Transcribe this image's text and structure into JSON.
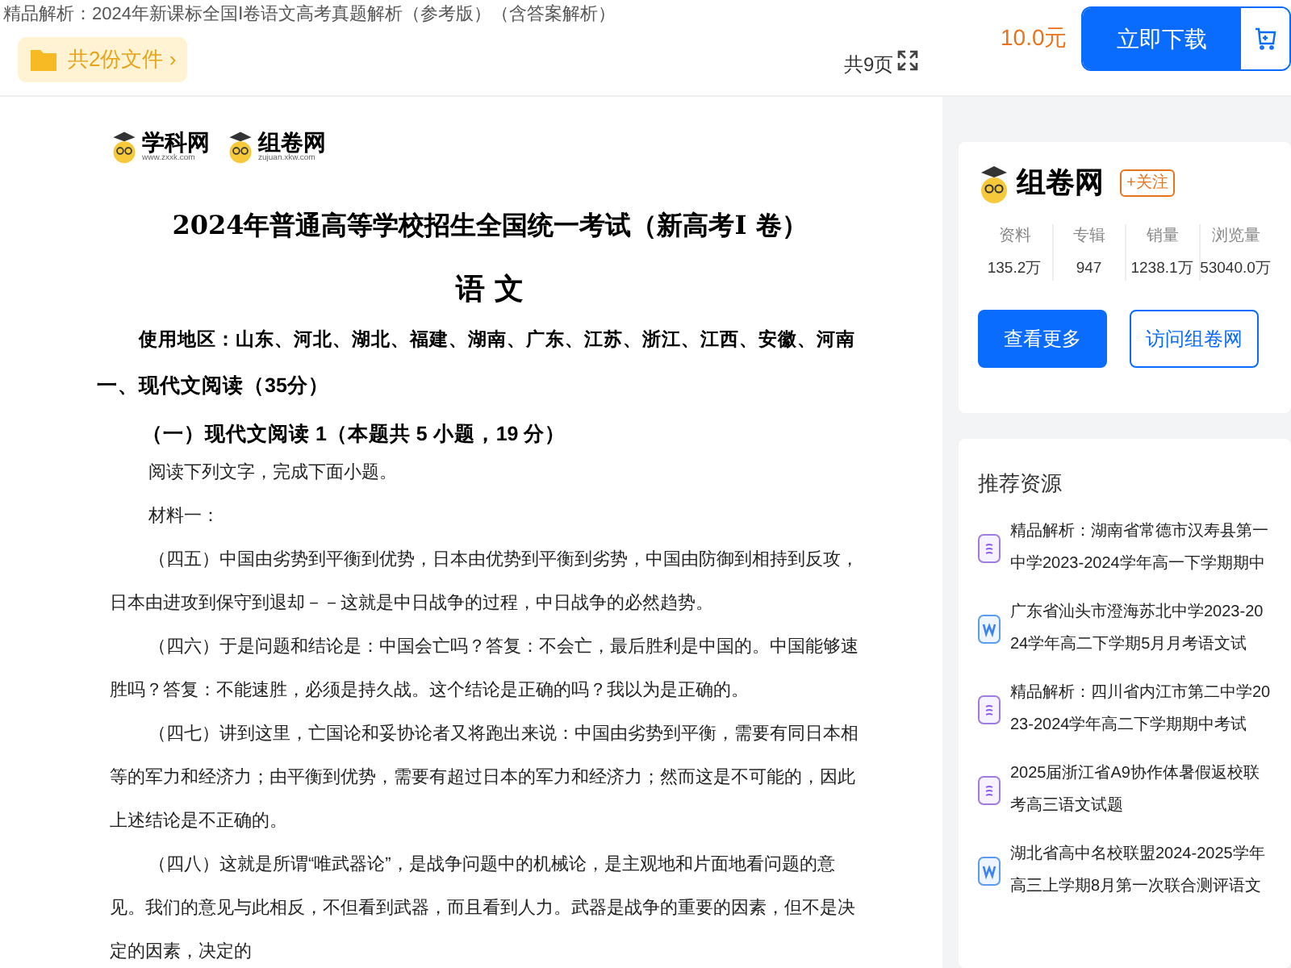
{
  "header": {
    "title": "精品解析：2024年新课标全国Ⅰ卷语文高考真题解析（参考版）（含答案解析）",
    "files_button": "共2份文件 ›",
    "page_count": "共9页",
    "price": "10.0元",
    "download_button": "立即下载"
  },
  "document": {
    "logos": [
      {
        "name": "学科网",
        "url": "www.zxxk.com"
      },
      {
        "name": "组卷网",
        "url": "zujuan.xkw.com"
      }
    ],
    "title": "2024年普通高等学校招生全国统一考试（新高考Ⅰ 卷）",
    "subject": "语 文",
    "region": "使用地区：山东、河北、湖北、福建、湖南、广东、江苏、浙江、江西、安徽、河南",
    "blocks": [
      {
        "kind": "section",
        "text": "一、现代文阅读（35分）"
      },
      {
        "kind": "subsection",
        "text": "（一）现代文阅读 1（本题共 5 小题，19 分）"
      },
      {
        "kind": "para",
        "text": "阅读下列文字，完成下面小题。"
      },
      {
        "kind": "para",
        "text": "材料一："
      },
      {
        "kind": "para",
        "text": "（四五）中国由劣势到平衡到优势，日本由优势到平衡到劣势，中国由防御到相持到反攻，日本由进攻到保守到退却－－这就是中日战争的过程，中日战争的必然趋势。"
      },
      {
        "kind": "para",
        "text": "（四六）于是问题和结论是：中国会亡吗？答复：不会亡，最后胜利是中国的。中国能够速胜吗？答复：不能速胜，必须是持久战。这个结论是正确的吗？我以为是正确的。"
      },
      {
        "kind": "para",
        "text": "（四七）讲到这里，亡国论和妥协论者又将跑出来说：中国由劣势到平衡，需要有同日本相等的军力和经济力；由平衡到优势，需要有超过日本的军力和经济力；然而这是不可能的，因此上述结论是不正确的。"
      },
      {
        "kind": "para",
        "text": "（四八）这就是所谓“唯武器论”，是战争问题中的机械论，是主观地和片面地看问题的意见。我们的意见与此相反，不但看到武器，而且看到人力。武器是战争的重要的因素，但不是决定的因素，决定的"
      }
    ]
  },
  "publisher": {
    "name": "组卷网",
    "follow_button": "+关注",
    "stats": [
      {
        "label": "资料",
        "value": "135.2万"
      },
      {
        "label": "专辑",
        "value": "947"
      },
      {
        "label": "销量",
        "value": "1238.1万"
      },
      {
        "label": "浏览量",
        "value": "53040.0万"
      }
    ],
    "more_button": "查看更多",
    "visit_button": "访问组卷网"
  },
  "recommended": {
    "heading": "推荐资源",
    "items": [
      {
        "kind": "other",
        "title": "精品解析：湖南省常德市汉寿县第一中学2023-2024学年高一下学期期中"
      },
      {
        "kind": "word",
        "title": "广东省汕头市澄海苏北中学2023-2024学年高二下学期5月月考语文试"
      },
      {
        "kind": "other",
        "title": "精品解析：四川省内江市第二中学2023-2024学年高二下学期期中考试"
      },
      {
        "kind": "other",
        "title": "2025届浙江省A9协作体暑假返校联考高三语文试题"
      },
      {
        "kind": "word",
        "title": "湖北省高中名校联盟2024-2025学年高三上学期8月第一次联合测评语文"
      }
    ]
  }
}
